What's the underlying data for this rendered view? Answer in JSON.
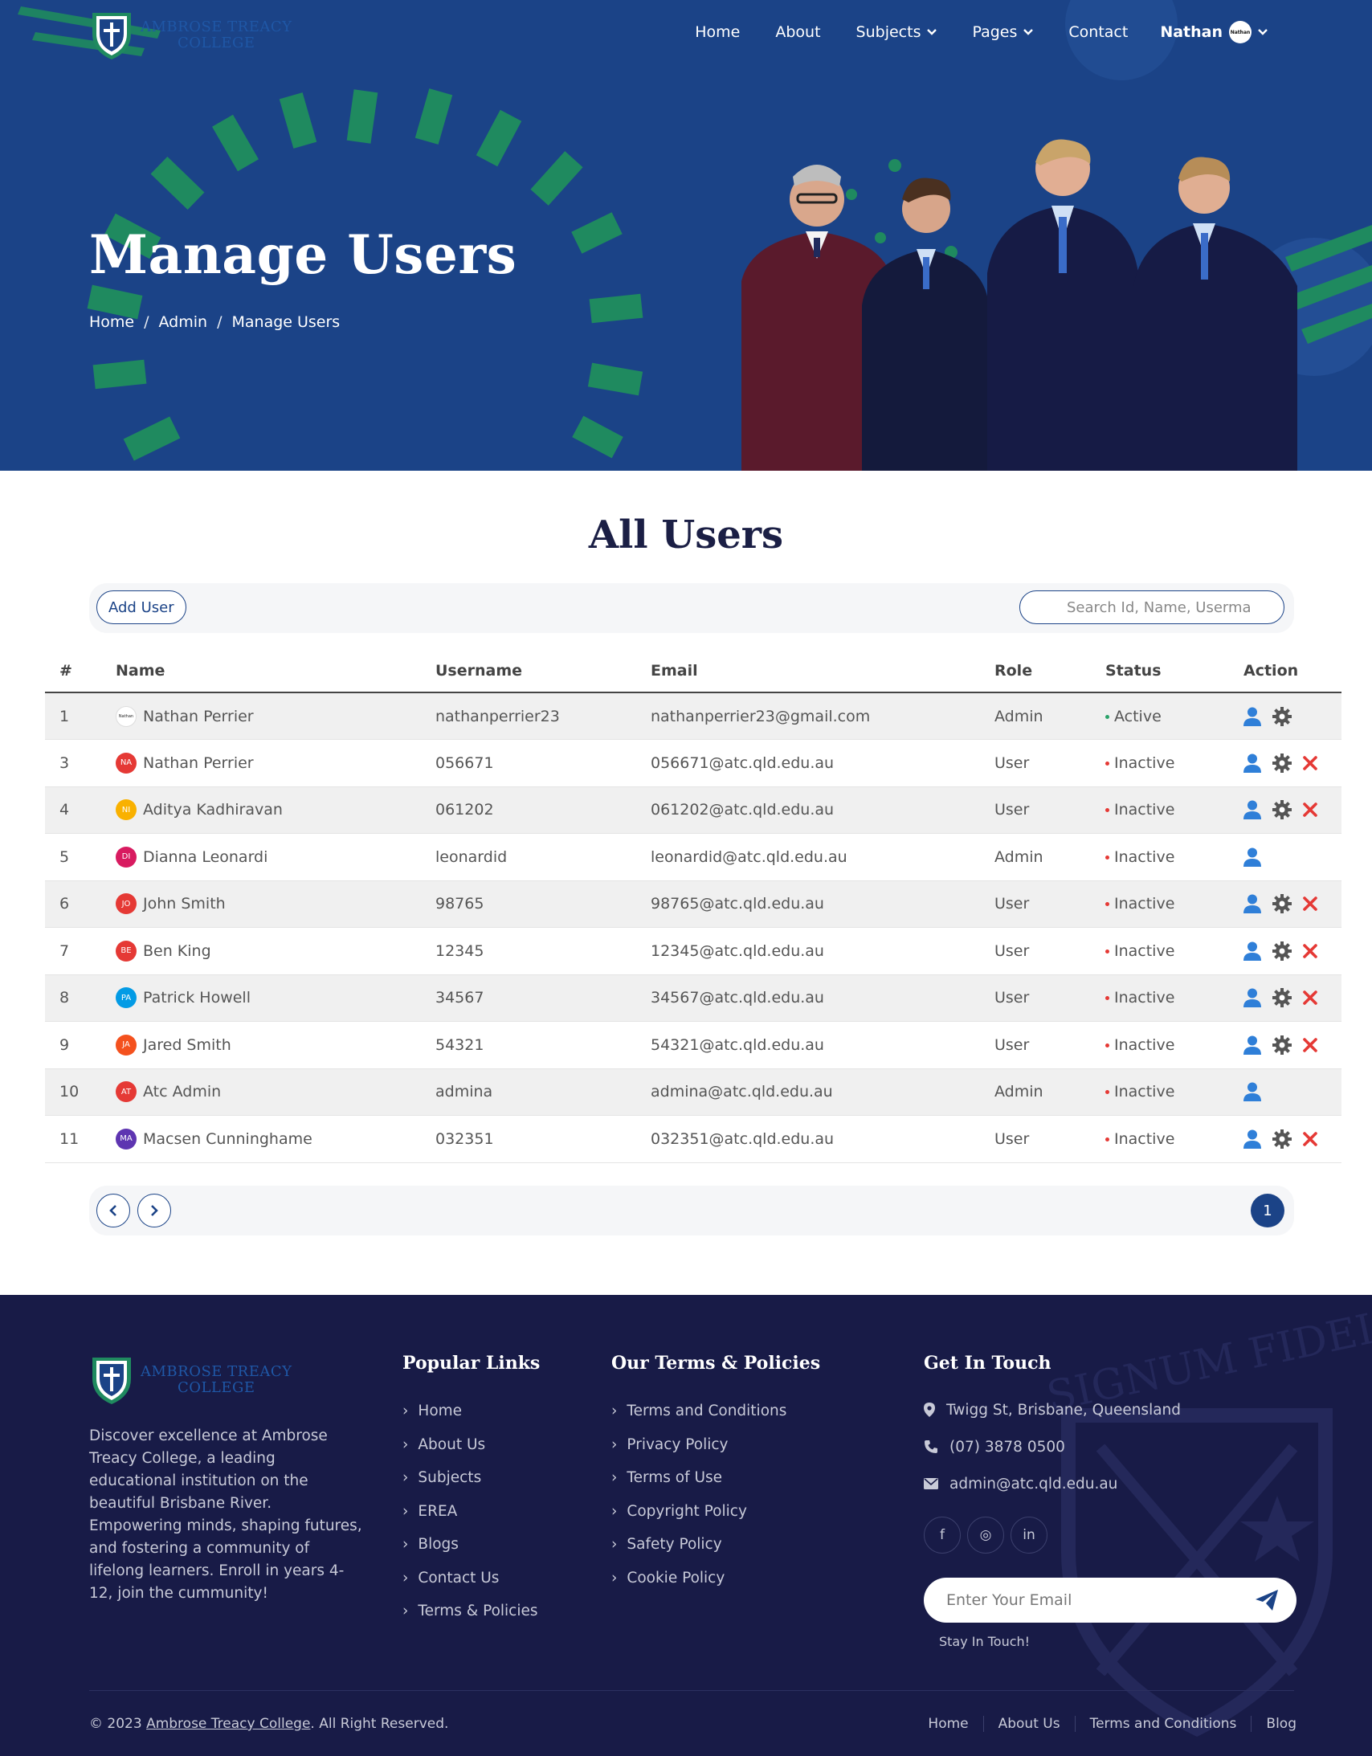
{
  "brand": {
    "logo_line1": "AMBROSE TREACY",
    "logo_line2": "COLLEGE",
    "accent": "#1b4387",
    "hero_bg": "#1b4387",
    "green": "#1f8a5f",
    "footer_bg": "#181b47"
  },
  "nav": {
    "items": [
      {
        "label": "Home",
        "dropdown": false
      },
      {
        "label": "About",
        "dropdown": false
      },
      {
        "label": "Subjects",
        "dropdown": true
      },
      {
        "label": "Pages",
        "dropdown": true
      },
      {
        "label": "Contact",
        "dropdown": false
      }
    ],
    "user_name": "Nathan",
    "user_avatar_text": "Nathan"
  },
  "hero": {
    "title": "Manage Users",
    "breadcrumb": [
      "Home",
      "Admin",
      "Manage Users"
    ],
    "breadcrumb_sep": "/"
  },
  "main": {
    "title": "All Users",
    "add_user_label": "Add User",
    "search_placeholder": "Search Id, Name, Userma",
    "columns": [
      "#",
      "Name",
      "Username",
      "Email",
      "Role",
      "Status",
      "Action"
    ],
    "rows": [
      {
        "id": "1",
        "initials": "Nathan",
        "avatar_color": "#ffffff",
        "name": "Nathan Perrier",
        "username": "nathanperrier23",
        "email": "nathanperrier23@gmail.com",
        "role": "Admin",
        "status": "Active",
        "status_color": "#2ba36a",
        "actions": [
          "view",
          "settings"
        ]
      },
      {
        "id": "3",
        "initials": "NA",
        "avatar_color": "#e53935",
        "name": "Nathan Perrier",
        "username": "056671",
        "email": "056671@atc.qld.edu.au",
        "role": "User",
        "status": "Inactive",
        "status_color": "#e53935",
        "actions": [
          "view",
          "settings",
          "delete"
        ]
      },
      {
        "id": "4",
        "initials": "NI",
        "avatar_color": "#f9b100",
        "name": "Aditya Kadhiravan",
        "username": "061202",
        "email": "061202@atc.qld.edu.au",
        "role": "User",
        "status": "Inactive",
        "status_color": "#e53935",
        "actions": [
          "view",
          "settings",
          "delete"
        ]
      },
      {
        "id": "5",
        "initials": "DI",
        "avatar_color": "#d81b60",
        "name": "Dianna Leonardi",
        "username": "leonardid",
        "email": "leonardid@atc.qld.edu.au",
        "role": "Admin",
        "status": "Inactive",
        "status_color": "#e53935",
        "actions": [
          "view"
        ]
      },
      {
        "id": "6",
        "initials": "JO",
        "avatar_color": "#e53935",
        "name": "John Smith",
        "username": "98765",
        "email": "98765@atc.qld.edu.au",
        "role": "User",
        "status": "Inactive",
        "status_color": "#e53935",
        "actions": [
          "view",
          "settings",
          "delete"
        ]
      },
      {
        "id": "7",
        "initials": "BE",
        "avatar_color": "#e53935",
        "name": "Ben King",
        "username": "12345",
        "email": "12345@atc.qld.edu.au",
        "role": "User",
        "status": "Inactive",
        "status_color": "#e53935",
        "actions": [
          "view",
          "settings",
          "delete"
        ]
      },
      {
        "id": "8",
        "initials": "PA",
        "avatar_color": "#039be5",
        "name": "Patrick Howell",
        "username": "34567",
        "email": "34567@atc.qld.edu.au",
        "role": "User",
        "status": "Inactive",
        "status_color": "#e53935",
        "actions": [
          "view",
          "settings",
          "delete"
        ]
      },
      {
        "id": "9",
        "initials": "JA",
        "avatar_color": "#f4511e",
        "name": "Jared Smith",
        "username": "54321",
        "email": "54321@atc.qld.edu.au",
        "role": "User",
        "status": "Inactive",
        "status_color": "#e53935",
        "actions": [
          "view",
          "settings",
          "delete"
        ]
      },
      {
        "id": "10",
        "initials": "AT",
        "avatar_color": "#e53935",
        "name": "Atc Admin",
        "username": "admina",
        "email": "admina@atc.qld.edu.au",
        "role": "Admin",
        "status": "Inactive",
        "status_color": "#e53935",
        "actions": [
          "view"
        ]
      },
      {
        "id": "11",
        "initials": "MA",
        "avatar_color": "#5e35b1",
        "name": "Macsen Cunninghame",
        "username": "032351",
        "email": "032351@atc.qld.edu.au",
        "role": "User",
        "status": "Inactive",
        "status_color": "#e53935",
        "actions": [
          "view",
          "settings",
          "delete"
        ]
      }
    ],
    "current_page": "1"
  },
  "footer": {
    "logo_line1": "AMBROSE TREACY",
    "logo_line2": "COLLEGE",
    "description": "Discover excellence at Ambrose Treacy College, a leading educational institution on the beautiful Brisbane River. Empowering minds, shaping futures, and fostering a community of lifelong learners. Enroll in years 4-12, join the cummunity!",
    "popular_title": "Popular Links",
    "popular_links": [
      "Home",
      "About Us",
      "Subjects",
      "EREA",
      "Blogs",
      "Contact Us",
      "Terms & Policies"
    ],
    "terms_title": "Our Terms & Policies",
    "terms_links": [
      "Terms and Conditions",
      "Privacy Policy",
      "Terms of Use",
      "Copyright Policy",
      "Safety Policy",
      "Cookie Policy"
    ],
    "touch_title": "Get In Touch",
    "address": "Twigg St, Brisbane, Queensland",
    "phone": "(07) 3878 0500",
    "email": "admin@atc.qld.edu.au",
    "socials": [
      "f",
      "◎",
      "in"
    ],
    "email_placeholder": "Enter Your Email",
    "stay_in_touch": "Stay In Touch!",
    "copyright_prefix": "© 2023 ",
    "copyright_link": "Ambrose Treacy College",
    "copyright_suffix": ". All Right Reserved.",
    "watermark": "SIGNUM FIDEI",
    "bottom_links": [
      "Home",
      "About Us",
      "Terms and Conditions",
      "Blog"
    ]
  }
}
